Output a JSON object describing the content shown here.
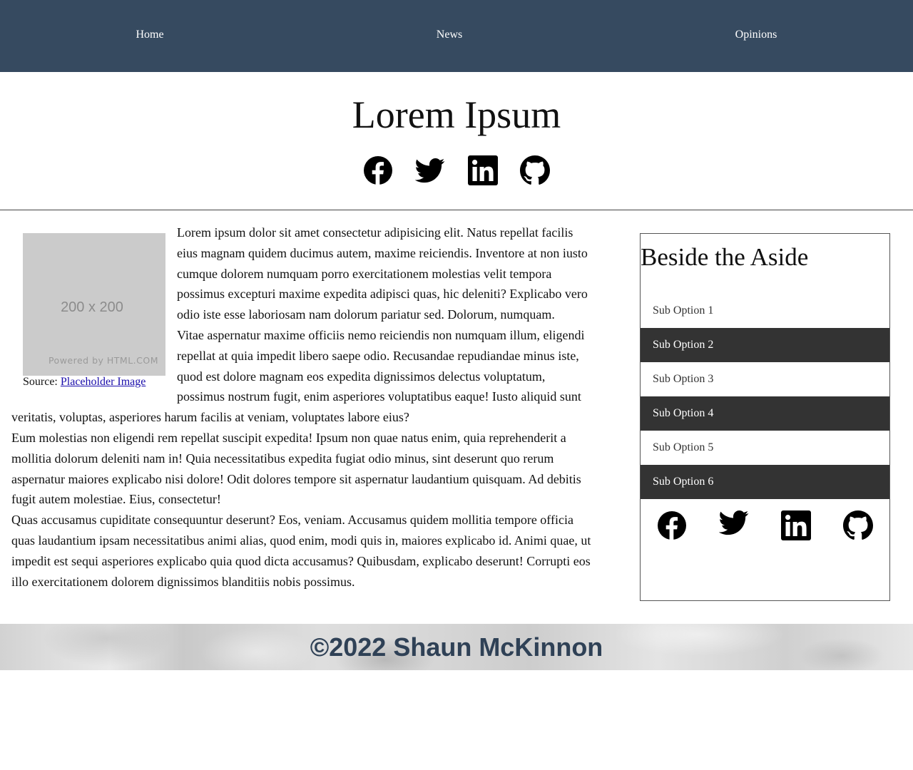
{
  "nav": {
    "items": [
      {
        "label": "Home"
      },
      {
        "label": "News"
      },
      {
        "label": "Opinions"
      }
    ]
  },
  "header": {
    "title": "Lorem Ipsum",
    "social_icons": [
      "facebook-icon",
      "twitter-icon",
      "linkedin-icon",
      "github-icon"
    ]
  },
  "figure": {
    "image_size_text": "200 x 200",
    "image_powered_text": "Powered by HTML.COM",
    "caption_prefix": "Source:",
    "caption_link": "Placeholder Image"
  },
  "article": {
    "paragraphs": [
      "Lorem ipsum dolor sit amet consectetur adipisicing elit. Natus repellat facilis eius magnam quidem ducimus autem, maxime reiciendis. Inventore at non iusto cumque dolorem numquam porro exercitationem molestias velit tempora possimus excepturi maxime expedita adipisci quas, hic deleniti? Explicabo vero odio iste esse laboriosam nam dolorum pariatur sed. Dolorum, numquam.",
      "Vitae aspernatur maxime officiis nemo reiciendis non numquam illum, eligendi repellat at quia impedit libero saepe odio. Recusandae repudiandae minus iste, quod est dolore magnam eos expedita dignissimos delectus voluptatum, possimus nostrum fugit, enim asperiores voluptatibus eaque! Iusto aliquid sunt veritatis, voluptas, asperiores harum facilis at veniam, voluptates labore eius?",
      "Eum molestias non eligendi rem repellat suscipit expedita! Ipsum non quae natus enim, quia reprehenderit a mollitia dolorum deleniti nam in! Quia necessitatibus expedita fugiat odio minus, sint deserunt quo rerum aspernatur maiores explicabo nisi dolore! Odit dolores tempore sit aspernatur laudantium quisquam. Ad debitis fugit autem molestiae. Eius, consectetur!",
      "Quas accusamus cupiditate consequuntur deserunt? Eos, veniam. Accusamus quidem mollitia tempore officia quas laudantium ipsam necessitatibus animi alias, quod enim, modi quis in, maiores explicabo id. Animi quae, ut impedit est sequi asperiores explicabo quia quod dicta accusamus? Quibusdam, explicabo deserunt! Corrupti eos illo exercitationem dolorem dignissimos blanditiis nobis possimus."
    ]
  },
  "aside": {
    "title": "Beside the Aside",
    "items": [
      {
        "label": "Sub Option 1"
      },
      {
        "label": "Sub Option 2"
      },
      {
        "label": "Sub Option 3"
      },
      {
        "label": "Sub Option 4"
      },
      {
        "label": "Sub Option 5"
      },
      {
        "label": "Sub Option 6"
      }
    ],
    "social_icons": [
      "facebook-icon",
      "twitter-icon",
      "linkedin-icon",
      "github-icon"
    ]
  },
  "footer": {
    "text": "©2022 Shaun McKinnon"
  },
  "colors": {
    "nav_bg": "#364a60",
    "aside_dark_item": "#333333",
    "footer_text": "#2f4156"
  }
}
